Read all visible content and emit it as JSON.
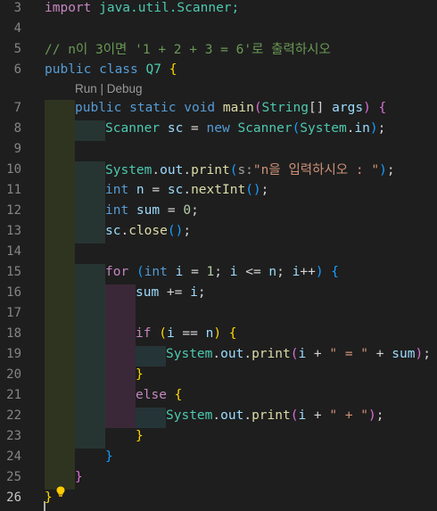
{
  "editor": {
    "codelens": {
      "run": "Run",
      "sep": " | ",
      "debug": "Debug"
    },
    "line_numbers": [
      "3",
      "4",
      "5",
      "6",
      "7",
      "8",
      "9",
      "10",
      "11",
      "12",
      "13",
      "14",
      "15",
      "16",
      "17",
      "18",
      "19",
      "20",
      "21",
      "22",
      "23",
      "24",
      "25",
      "26"
    ],
    "lines": {
      "l3": {
        "import": "import",
        "pkg": " java.util.Scanner;"
      },
      "l5": {
        "comment": "// n이 3이면 '1 + 2 + 3 = 6'로 출력하시오"
      },
      "l6": {
        "public": "public",
        "class": " class",
        "name": " Q7 ",
        "brace": "{"
      },
      "l7": {
        "public": "public",
        "static": " static",
        "void": " void",
        "main": " main",
        "p1": "(",
        "type": "String",
        "arr": "[]",
        "args": " args",
        "p2": ")",
        "space": " ",
        "brace": "{"
      },
      "l8": {
        "type": "Scanner",
        "var": " sc",
        "eq": " = ",
        "new": "new",
        "ctor": " Scanner",
        "p1": "(",
        "sys": "System",
        "dot": ".",
        "in": "in",
        "p2": ")",
        "semi": ";"
      },
      "l10": {
        "sys": "System",
        "dot1": ".",
        "out": "out",
        "dot2": ".",
        "print": "print",
        "p1": "(",
        "hint": "s:",
        "str": "\"n을 입력하시오 : \"",
        "p2": ")",
        "semi": ";"
      },
      "l11": {
        "int": "int",
        "var": " n",
        "eq": " = ",
        "sc": "sc",
        "dot": ".",
        "fn": "nextInt",
        "p": "()",
        "semi": ";"
      },
      "l12": {
        "int": "int",
        "var": " sum",
        "eq": " = ",
        "num": "0",
        "semi": ";"
      },
      "l13": {
        "sc": "sc",
        "dot": ".",
        "fn": "close",
        "p": "()",
        "semi": ";"
      },
      "l15": {
        "for": "for",
        "sp": " ",
        "p1": "(",
        "int": "int",
        "i": " i",
        "eq": " = ",
        "one": "1",
        "s1": "; ",
        "i2": "i",
        "le": " <= ",
        "n": "n",
        "s2": "; ",
        "i3": "i",
        "inc": "++",
        "p2": ")",
        "sp2": " ",
        "brace": "{"
      },
      "l16": {
        "sum": "sum",
        "op": " += ",
        "i": "i",
        "semi": ";"
      },
      "l18": {
        "if": "if",
        "sp": " ",
        "p1": "(",
        "i": "i",
        "eq": " == ",
        "n": "n",
        "p2": ")",
        "sp2": " ",
        "brace": "{"
      },
      "l19": {
        "sys": "System",
        "dot1": ".",
        "out": "out",
        "dot2": ".",
        "print": "print",
        "p1": "(",
        "i": "i",
        "plus1": " + ",
        "str": "\" = \"",
        "plus2": " + ",
        "sum": "sum",
        "p2": ")",
        "semi": ";"
      },
      "l20": {
        "brace": "}"
      },
      "l21": {
        "else": "else",
        "sp": " ",
        "brace": "{"
      },
      "l22": {
        "sys": "System",
        "dot1": ".",
        "out": "out",
        "dot2": ".",
        "print": "print",
        "p1": "(",
        "i": "i",
        "plus1": " + ",
        "str": "\" + \"",
        "p2": ")",
        "semi": ";"
      },
      "l23": {
        "brace": "}"
      },
      "l24": {
        "brace": "}"
      },
      "l25": {
        "brace": "}"
      },
      "l26": {
        "brace": "}"
      }
    },
    "icons": {
      "lightbulb": "lightbulb-icon"
    },
    "colors": {
      "background": "#1e1e1e",
      "keyword": "#569cd6",
      "control": "#c586c0",
      "type": "#4ec9b0",
      "function": "#dcdcaa",
      "variable": "#9cdcfe",
      "string": "#ce9178",
      "comment": "#6a9955",
      "lightbulb": "#ffcc00"
    }
  }
}
